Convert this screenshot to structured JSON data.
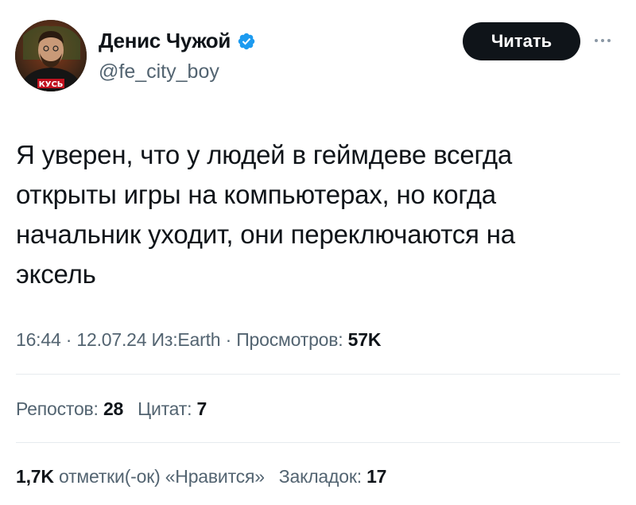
{
  "author": {
    "display_name": "Денис Чужой",
    "handle": "@fe_city_boy",
    "avatar_shirt_text": "КУСЬ"
  },
  "actions": {
    "follow_label": "Читать",
    "more_icon": "more-horizontal-icon"
  },
  "tweet": {
    "text": "Я уверен, что у людей в геймдеве всегда\nоткрыты игры на компьютерах, но когда\nначальник уходит, они переключаются на\nэксель"
  },
  "meta": {
    "time": "16:44",
    "sep1": " · ",
    "date": "12.07.24",
    "source": " Из:Earth",
    "sep2": " · ",
    "views_label": "Просмотров: ",
    "views_value": "57K"
  },
  "stats_row1": {
    "reposts_label": "Репостов: ",
    "reposts_value": "28",
    "quotes_label": "Цитат: ",
    "quotes_value": "7"
  },
  "stats_row2": {
    "likes_value": "1,7K",
    "likes_label": " отметки(-ок) «Нравится»",
    "bookmarks_label": "Закладок: ",
    "bookmarks_value": "17"
  },
  "colors": {
    "verified_badge": "#1d9bf0",
    "follow_button": "#0f1419",
    "secondary_text": "#536471"
  }
}
